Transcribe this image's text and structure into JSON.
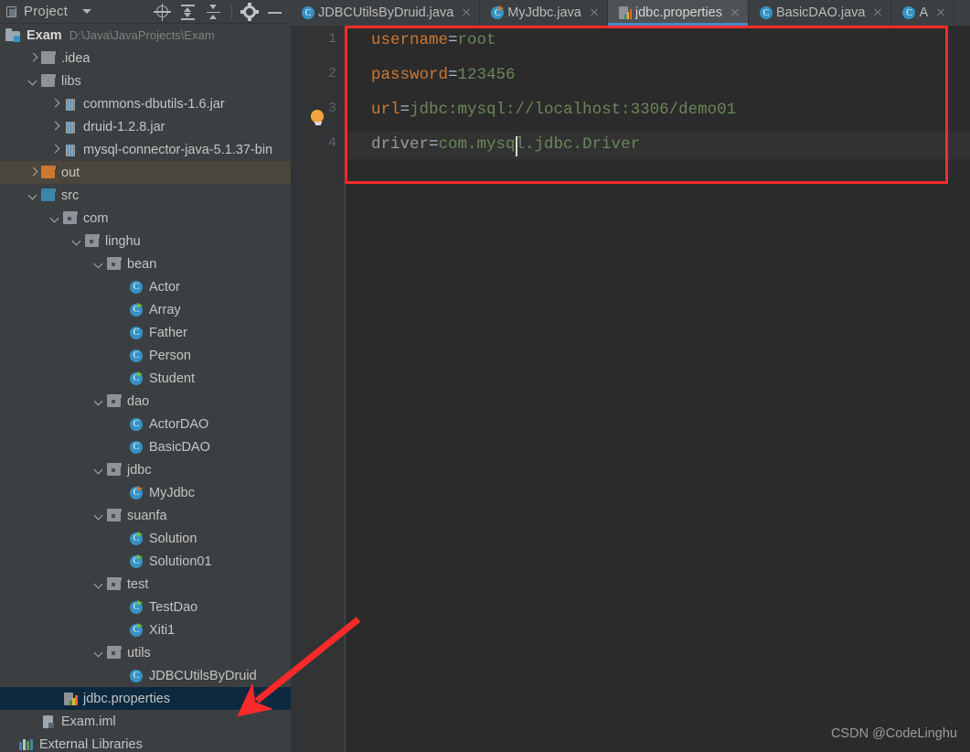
{
  "panel": {
    "title": "Project",
    "icon": "project-panel-icon",
    "toolbar": [
      {
        "name": "locate-in-tree-icon",
        "label": "Select Opened File"
      },
      {
        "name": "expand-all-icon",
        "label": "Expand All"
      },
      {
        "name": "collapse-all-icon",
        "label": "Collapse All"
      },
      {
        "name": "gear-icon",
        "label": "Settings"
      },
      {
        "name": "minimize-icon",
        "label": "Hide"
      }
    ],
    "root": {
      "name": "Exam",
      "path": "D:\\Java\\JavaProjects\\Exam"
    },
    "tree": [
      {
        "label": ".idea",
        "depth": 1,
        "icon": "folder",
        "color": "gray",
        "chev": "closed",
        "state": "normal"
      },
      {
        "label": "libs",
        "depth": 1,
        "icon": "folder",
        "color": "gray",
        "chev": "open",
        "state": "normal"
      },
      {
        "label": "commons-dbutils-1.6.jar",
        "depth": 2,
        "icon": "jar",
        "color": "",
        "chev": "closed",
        "state": "normal"
      },
      {
        "label": "druid-1.2.8.jar",
        "depth": 2,
        "icon": "jar",
        "color": "",
        "chev": "closed",
        "state": "normal"
      },
      {
        "label": "mysql-connector-java-5.1.37-bin",
        "depth": 2,
        "icon": "jar",
        "color": "",
        "chev": "closed",
        "state": "normal"
      },
      {
        "label": "out",
        "depth": 1,
        "icon": "folder",
        "color": "orange",
        "chev": "closed",
        "state": "hover"
      },
      {
        "label": "src",
        "depth": 1,
        "icon": "folder",
        "color": "blue",
        "chev": "open",
        "state": "normal"
      },
      {
        "label": "com",
        "depth": 2,
        "icon": "package",
        "color": "gray",
        "chev": "open",
        "state": "normal"
      },
      {
        "label": "linghu",
        "depth": 3,
        "icon": "package",
        "color": "gray",
        "chev": "open",
        "state": "normal"
      },
      {
        "label": "bean",
        "depth": 4,
        "icon": "package",
        "color": "gray",
        "chev": "open",
        "state": "normal"
      },
      {
        "label": "Actor",
        "depth": 5,
        "icon": "class",
        "run": "none",
        "chev": "none",
        "state": "normal"
      },
      {
        "label": "Array",
        "depth": 5,
        "icon": "class",
        "run": "green",
        "chev": "none",
        "state": "normal"
      },
      {
        "label": "Father",
        "depth": 5,
        "icon": "class",
        "run": "none",
        "chev": "none",
        "state": "normal"
      },
      {
        "label": "Person",
        "depth": 5,
        "icon": "class",
        "run": "none",
        "chev": "none",
        "state": "normal"
      },
      {
        "label": "Student",
        "depth": 5,
        "icon": "class",
        "run": "green",
        "chev": "none",
        "state": "normal"
      },
      {
        "label": "dao",
        "depth": 4,
        "icon": "package",
        "color": "gray",
        "chev": "open",
        "state": "normal"
      },
      {
        "label": "ActorDAO",
        "depth": 5,
        "icon": "class",
        "run": "none",
        "chev": "none",
        "state": "normal"
      },
      {
        "label": "BasicDAO",
        "depth": 5,
        "icon": "class",
        "run": "none",
        "chev": "none",
        "state": "normal"
      },
      {
        "label": "jdbc",
        "depth": 4,
        "icon": "package",
        "color": "gray",
        "chev": "open",
        "state": "normal"
      },
      {
        "label": "MyJdbc",
        "depth": 5,
        "icon": "class",
        "run": "orange",
        "chev": "none",
        "state": "normal"
      },
      {
        "label": "suanfa",
        "depth": 4,
        "icon": "package",
        "color": "gray",
        "chev": "open",
        "state": "normal"
      },
      {
        "label": "Solution",
        "depth": 5,
        "icon": "class",
        "run": "green",
        "chev": "none",
        "state": "normal"
      },
      {
        "label": "Solution01",
        "depth": 5,
        "icon": "class",
        "run": "green",
        "chev": "none",
        "state": "normal"
      },
      {
        "label": "test",
        "depth": 4,
        "icon": "package",
        "color": "gray",
        "chev": "open",
        "state": "normal"
      },
      {
        "label": "TestDao",
        "depth": 5,
        "icon": "class",
        "run": "green",
        "chev": "none",
        "state": "normal"
      },
      {
        "label": "Xiti1",
        "depth": 5,
        "icon": "class",
        "run": "green",
        "chev": "none",
        "state": "normal"
      },
      {
        "label": "utils",
        "depth": 4,
        "icon": "package",
        "color": "gray",
        "chev": "open",
        "state": "normal"
      },
      {
        "label": "JDBCUtilsByDruid",
        "depth": 5,
        "icon": "class",
        "run": "none",
        "chev": "none",
        "state": "normal"
      },
      {
        "label": "jdbc.properties",
        "depth": 2,
        "icon": "properties",
        "color": "",
        "chev": "none",
        "state": "selected"
      },
      {
        "label": "Exam.iml",
        "depth": 1,
        "icon": "iml",
        "color": "",
        "chev": "none",
        "state": "normal"
      },
      {
        "label": "External Libraries",
        "depth": 0,
        "icon": "extlib",
        "color": "",
        "chev": "none",
        "state": "normal"
      }
    ]
  },
  "tabs": [
    {
      "label": "JDBCUtilsByDruid.java",
      "icon": "java-class-icon",
      "active": false,
      "run": "none"
    },
    {
      "label": "MyJdbc.java",
      "icon": "java-class-icon",
      "active": false,
      "run": "orange"
    },
    {
      "label": "jdbc.properties",
      "icon": "properties-file-icon",
      "active": true,
      "run": "none"
    },
    {
      "label": "BasicDAO.java",
      "icon": "java-class-icon",
      "active": false,
      "run": "none"
    },
    {
      "label": "A",
      "icon": "java-class-icon",
      "active": false,
      "run": "none"
    }
  ],
  "editor": {
    "line_numbers": [
      "1",
      "2",
      "3",
      "4"
    ],
    "lines": [
      {
        "key": "username",
        "key_style": "key",
        "sep": "=",
        "value": "root"
      },
      {
        "key": "password",
        "key_style": "key",
        "sep": "=",
        "value": "123456"
      },
      {
        "key": "url",
        "key_style": "key",
        "sep": "=",
        "value": "jdbc:mysql://localhost:3306/demo01"
      },
      {
        "key": "driver",
        "key_style": "muted",
        "sep": "=",
        "value": "com.mysql.jdbc.Driver"
      }
    ],
    "current_line": 4,
    "bulb_line": 3,
    "bulb_icon": "lightbulb-intention-icon"
  },
  "annotations": {
    "highlight_box_color": "#fc2a2a",
    "arrow_color": "#fc2a2a",
    "arrow_name": "pointer-arrow-annotation"
  },
  "watermark": "CSDN @CodeLinghu",
  "colors": {
    "accent": "#4a88c7",
    "panel_bg": "#3c3f41",
    "editor_bg": "#2b2b2b",
    "gutter_bg": "#313335",
    "selection": "#0d293e",
    "hover": "#4a463c",
    "key": "#cc7832",
    "value": "#6a8759",
    "muted_key": "#9a9a9a"
  }
}
